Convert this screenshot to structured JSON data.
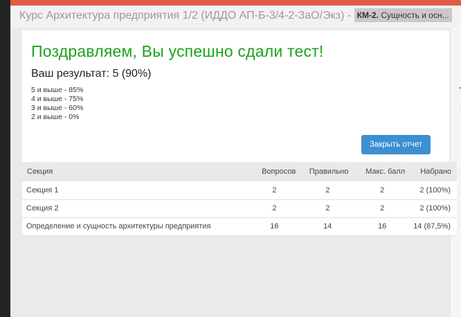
{
  "header": {
    "course_title": "Курс Архитектура предприятия 1/2 (ИДДО АП-Б-3/4-2-ЗаО/Экз)",
    "separator": "-",
    "module_code": "КМ-2.",
    "module_title": "Сущность и осн..."
  },
  "result": {
    "message": "Поздравляем, Вы успешно сдали тест!",
    "score_line": "Ваш результат: 5 (90%)",
    "grade_scale": [
      "5 и выше - 85%",
      "4 и выше - 75%",
      "3 и выше - 60%",
      "2 и выше - 0%"
    ],
    "close_button_label": "Закрыть отчет",
    "message_color": "#1ba21b",
    "button_color": "#3c8fd1"
  },
  "table": {
    "headers": [
      "Секция",
      "Вопросов",
      "Правильно",
      "Макс. балл",
      "Набрано"
    ],
    "rows": [
      [
        "Секция 1",
        "2",
        "2",
        "2",
        "2 (100%)"
      ],
      [
        "Секция 2",
        "2",
        "2",
        "2",
        "2 (100%)"
      ],
      [
        "Определение и сущность архитектуры предприятия",
        "16",
        "14",
        "16",
        "14 (87,5%)"
      ]
    ]
  },
  "colors": {
    "top_bar": "#e05a47",
    "accent": "#e88a3e"
  }
}
